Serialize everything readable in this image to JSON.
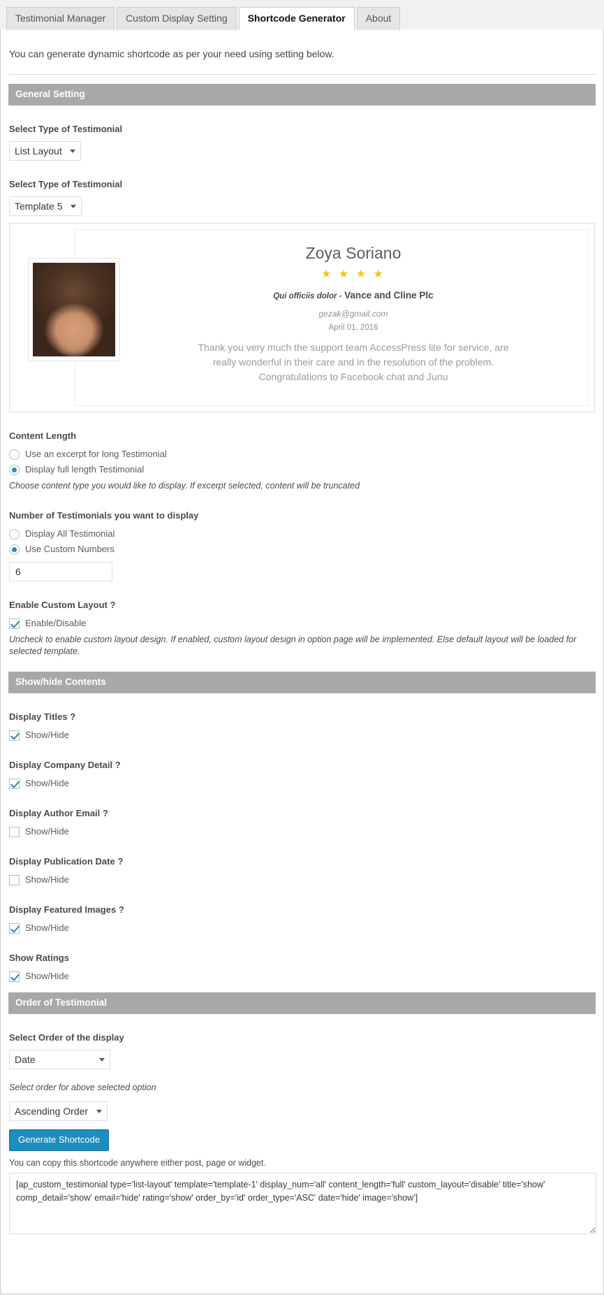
{
  "tabs": [
    {
      "label": "Testimonial Manager",
      "active": false
    },
    {
      "label": "Custom Display Setting",
      "active": false
    },
    {
      "label": "Shortcode Generator",
      "active": true
    },
    {
      "label": "About",
      "active": false
    }
  ],
  "intro": "You can generate dynamic shortcode as per your need using setting below.",
  "sections": {
    "general": "General Setting",
    "showhide": "Show/hide Contents",
    "order": "Order of Testimonial"
  },
  "general": {
    "type_label": "Select Type of Testimonial",
    "type_value": "List Layout",
    "template_label": "Select Type of Testimonial",
    "template_value": "Template 5"
  },
  "preview": {
    "name": "Zoya Soriano",
    "stars": "★ ★ ★ ★",
    "star_count": 4,
    "star_color": "#f5c518",
    "position": "Qui officiis dolor -",
    "company": "Vance and Cline Plc",
    "email": "gezak@gmail.com",
    "date": "April 01, 2016",
    "content": "Thank you very much the support team AccessPress lite for service, are really wonderful in their care and in the resolution of the problem. Congratulations to Facebook chat and Junu"
  },
  "content_length": {
    "label": "Content Length",
    "options": [
      {
        "label": "Use an excerpt for long Testimonial",
        "selected": false
      },
      {
        "label": "Display full length Testimonial",
        "selected": true
      }
    ],
    "help": "Choose content type you would like to display. If excerpt selected, content will be truncated"
  },
  "number": {
    "label": "Number of Testimonials you want to display",
    "options": [
      {
        "label": "Display All Testimonial",
        "selected": false
      },
      {
        "label": "Use Custom Numbers",
        "selected": true
      }
    ],
    "value": "6"
  },
  "custom_layout": {
    "label": "Enable Custom Layout ?",
    "checkbox_label": "Enable/Disable",
    "checked": true,
    "help": "Uncheck to enable custom layout design. If enabled, custom layout design in option page will be implemented. Else default layout will be loaded for selected template."
  },
  "showhide_items": [
    {
      "label": "Display Titles ?",
      "checkbox_label": "Show/Hide",
      "checked": true
    },
    {
      "label": "Display Company Detail ?",
      "checkbox_label": "Show/Hide",
      "checked": true
    },
    {
      "label": "Display Author Email ?",
      "checkbox_label": "Show/Hide",
      "checked": false
    },
    {
      "label": "Display Publication Date ?",
      "checkbox_label": "Show/Hide",
      "checked": false
    },
    {
      "label": "Display Featured Images ?",
      "checkbox_label": "Show/Hide",
      "checked": true
    },
    {
      "label": "Show Ratings",
      "checkbox_label": "Show/Hide",
      "checked": true
    }
  ],
  "order": {
    "order_label": "Select Order of the display",
    "order_value": "Date",
    "type_help": "Select order for above selected option",
    "type_value": "Ascending Order"
  },
  "generate": {
    "button_label": "Generate Shortcode",
    "copy_note": "You can copy this shortcode anywhere either post, page or widget.",
    "shortcode": "[ap_custom_testimonial type='list-layout' template='template-1' display_num='all' content_length='full' custom_layout='disable' title='show' comp_detail='show' email='hide' rating='show' order_by='id' order_type='ASC' date='hide' image='show']"
  },
  "colors": {
    "accent": "#1e8cbe",
    "section_bar": "#a8a8a8",
    "star": "#f5c518"
  }
}
